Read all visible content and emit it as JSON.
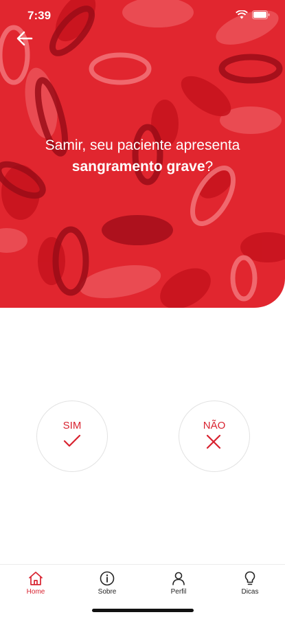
{
  "status_bar": {
    "time": "7:39"
  },
  "hero": {
    "question_line1": "Samir, seu paciente apresenta",
    "question_bold": "sangramento grave",
    "question_end": "?"
  },
  "answers": {
    "yes_label": "SIM",
    "no_label": "NÃO"
  },
  "bottom_nav": {
    "items": [
      {
        "label": "Home",
        "icon": "home-icon",
        "active": true
      },
      {
        "label": "Sobre",
        "icon": "info-icon",
        "active": false
      },
      {
        "label": "Perfil",
        "icon": "user-icon",
        "active": false
      },
      {
        "label": "Dicas",
        "icon": "lightbulb-icon",
        "active": false
      }
    ]
  },
  "colors": {
    "primary": "#d8222f",
    "hero_background": "#e1262f",
    "cell_dark": "#a8101c",
    "cell_light": "#f47a7f"
  }
}
